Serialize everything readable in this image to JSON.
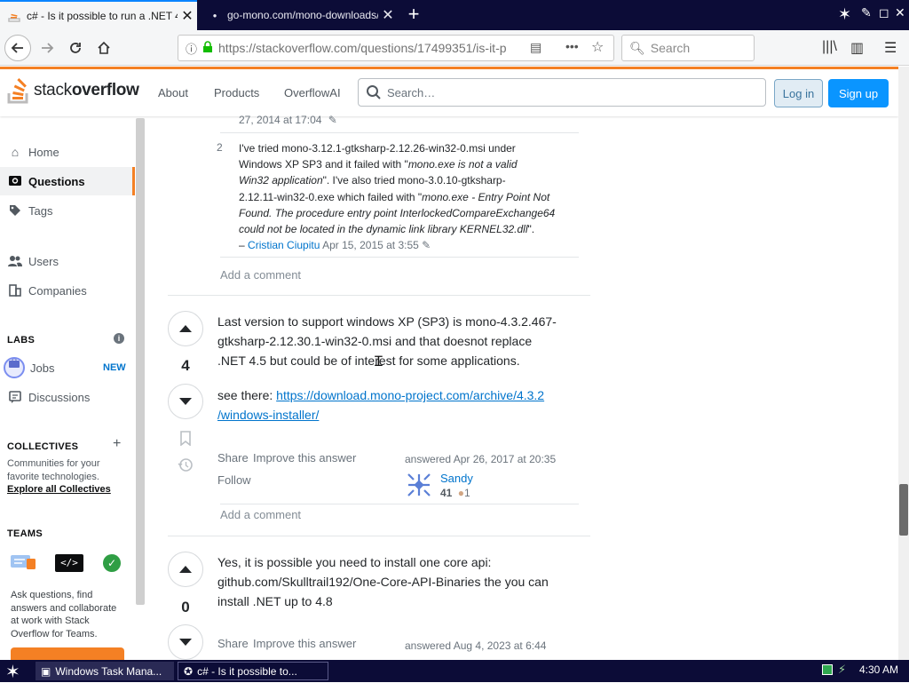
{
  "browser": {
    "tabs": [
      {
        "title": "c# - Is it possible to run a .NET 4.",
        "active": true
      },
      {
        "title": "go-mono.com/mono-downloads/d",
        "active": false
      }
    ],
    "url": "https://stackoverflow.com/questions/17499351/is-it-p",
    "search_placeholder": "Search"
  },
  "so_header": {
    "logo_word_light": "stack",
    "logo_word_bold": "overflow",
    "nav": [
      "About",
      "Products",
      "OverflowAI"
    ],
    "search_placeholder": "Search…",
    "login": "Log in",
    "signup": "Sign up"
  },
  "sidebar": {
    "home": "Home",
    "questions": "Questions",
    "tags": "Tags",
    "users": "Users",
    "companies": "Companies",
    "labs_heading": "LABS",
    "jobs": "Jobs",
    "new_badge": "NEW",
    "discussions": "Discussions",
    "collectives_heading": "COLLECTIVES",
    "collectives_desc_1": "Communities for your",
    "collectives_desc_2": "favorite technologies.",
    "explore_collectives": "Explore all Collectives",
    "teams_heading": "TEAMS",
    "teams_desc_1": "Ask questions, find",
    "teams_desc_2": "answers and collaborate",
    "teams_desc_3": "at work with Stack",
    "teams_desc_4": "Overflow for Teams."
  },
  "prev_comment_tail": {
    "timestamp": "27, 2014 at 17:04"
  },
  "comment": {
    "score": "2",
    "lines": [
      {
        "plain": "I've tried mono-3.12.1-gtksharp-2.12.26-win32-0.msi under",
        "italic": ""
      },
      {
        "plain": "Windows XP SP3 and it failed with \"",
        "italic": "mono.exe is not a valid"
      },
      {
        "plain": "",
        "italic": "Win32 application",
        "after": "\". I've also tried mono-3.0.10-gtksharp-"
      },
      {
        "plain": "2.12.11-win32-0.exe which failed with \"",
        "italic": "mono.exe - Entry Point Not"
      },
      {
        "plain": "",
        "italic": "Found. The procedure entry point InterlockedCompareExchange64"
      },
      {
        "plain": "",
        "italic": "could not be located in the dynamic link library KERNEL32.dll",
        "after": "\"."
      }
    ],
    "author_prefix": "–",
    "author": "Cristian Ciupitu",
    "date": "Apr 15, 2015 at 3:55",
    "add_comment": "Add a comment"
  },
  "answer1": {
    "votes": "4",
    "text_lines": [
      "Last version to support windows XP (SP3) is mono-4.3.2.467-",
      "gtksharp-2.12.30.1-win32-0.msi and that doesnot replace",
      ".NET 4.5 but could be of interest for some applications."
    ],
    "see_there": "see there: ",
    "link_line1": "https://download.mono-project.com/archive/4.3.2",
    "link_line2": "/windows-installer/",
    "share": "Share",
    "improve": "Improve this answer",
    "follow": "Follow",
    "answered": "answered Apr 26, 2017 at 20:35",
    "user": "Sandy",
    "rep": "41",
    "bronze": "1",
    "add_comment": "Add a comment"
  },
  "answer2": {
    "votes": "0",
    "text_lines": [
      "Yes, it is possible you need to install one core api:",
      "github.com/Skulltrail192/One-Core-API-Binaries the you can",
      "install .NET up to 4.8"
    ],
    "share": "Share",
    "improve": "Improve this answer",
    "answered": "answered Aug 4, 2023 at 6:44"
  },
  "taskbar": {
    "item1": "Windows Task Mana...",
    "item2": "c# - Is it possible to...",
    "clock": "4:30 AM"
  },
  "colors": {
    "so_orange": "#f48024",
    "so_blue": "#0a95ff",
    "link_blue": "#0074cc",
    "taskbar_bg": "#0c0c37"
  }
}
